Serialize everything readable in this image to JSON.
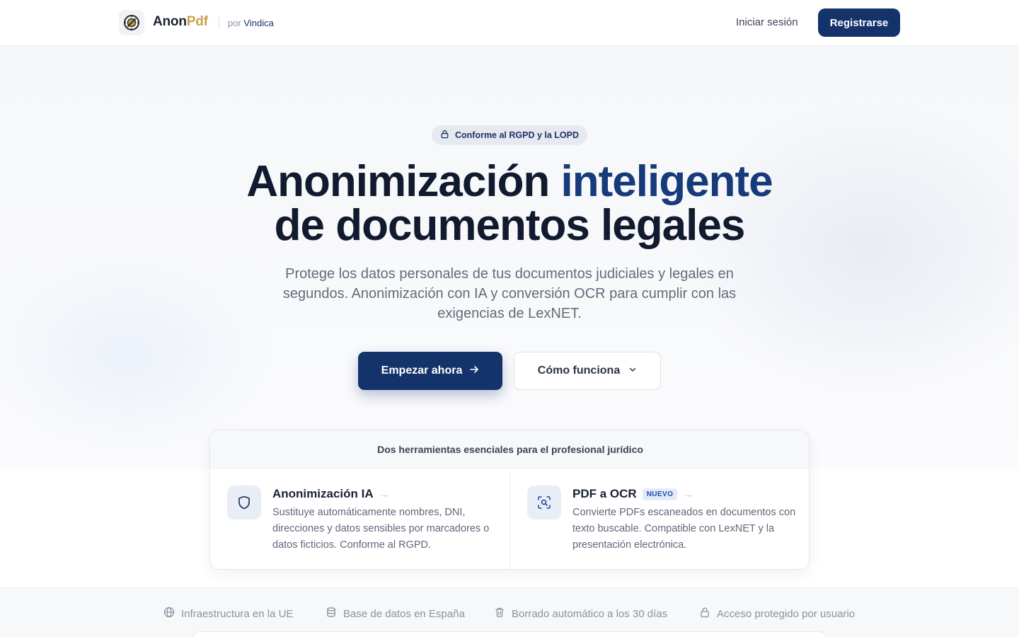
{
  "header": {
    "brand_primary": "Anon",
    "brand_accent": "Pdf",
    "byline_prefix": "por",
    "byline_org": "Vindica",
    "login_label": "Iniciar sesión",
    "register_label": "Registrarse"
  },
  "hero": {
    "badge": "Conforme al RGPD y la LOPD",
    "title_part1": "Anonimización",
    "title_highlight": "inteligente",
    "title_line2": "de documentos legales",
    "subtitle": "Protege los datos personales de tus documentos judiciales y legales en segundos. Anonimización con IA y conversión OCR para cumplir con las exigencias de LexNET.",
    "cta_primary": "Empezar ahora",
    "cta_secondary": "Cómo funciona"
  },
  "tools": {
    "header": "Dos herramientas esenciales para el profesional jurídico",
    "items": [
      {
        "title": "Anonimización IA",
        "badge": "",
        "description": "Sustituye automáticamente nombres, DNI, direcciones y datos sensibles por marcadores o datos ficticios. Conforme al RGPD.",
        "icon": "shield-icon"
      },
      {
        "title": "PDF a OCR",
        "badge": "NUEVO",
        "description": "Convierte PDFs escaneados en documentos con texto buscable. Compatible con LexNET y la presentación electrónica.",
        "icon": "scan-search-icon"
      }
    ]
  },
  "trust": [
    {
      "label": "Infraestructura en la UE",
      "icon": "globe-icon"
    },
    {
      "label": "Base de datos en España",
      "icon": "database-icon"
    },
    {
      "label": "Borrado automático a los 30 días",
      "icon": "trash-icon"
    },
    {
      "label": "Acceso protegido por usuario",
      "icon": "lock-icon"
    }
  ],
  "colors": {
    "primary": "#14336b",
    "accent_gold": "#c8a24a",
    "title_highlight": "#163a7a",
    "text_dark": "#111a2e",
    "text_muted": "#636b7b"
  }
}
